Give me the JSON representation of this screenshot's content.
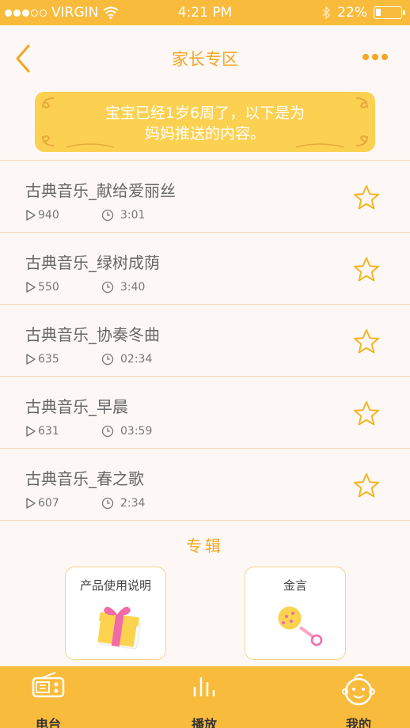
{
  "status_bar": {
    "carrier": "VIRGIN",
    "signal_filled": 3,
    "signal_total": 5,
    "time": "4:21 PM",
    "battery_percent": "22%",
    "battery_level": 0.22
  },
  "nav": {
    "title": "家长专区"
  },
  "banner": {
    "line1": "宝宝已经1岁6周了，以下是为",
    "line2": "妈妈推送的内容。"
  },
  "tracks": [
    {
      "title": "古典音乐_献给爱丽丝",
      "plays": "940",
      "duration": "3:01"
    },
    {
      "title": "古典音乐_绿树成荫",
      "plays": "550",
      "duration": "3:40"
    },
    {
      "title": "古典音乐_协奏冬曲",
      "plays": "635",
      "duration": "02:34"
    },
    {
      "title": "古典音乐_早晨",
      "plays": "631",
      "duration": "03:59"
    },
    {
      "title": "古典音乐_春之歌",
      "plays": "607",
      "duration": "2:34"
    }
  ],
  "albums": {
    "title": "专辑",
    "items": [
      {
        "label": "产品使用说明",
        "icon": "gift-icon"
      },
      {
        "label": "金言",
        "icon": "rattle-icon"
      }
    ]
  },
  "tabbar": {
    "items": [
      {
        "label": "电台",
        "icon": "radio-icon"
      },
      {
        "label": "播放",
        "icon": "equalizer-icon"
      },
      {
        "label": "我的",
        "icon": "baby-face-icon"
      }
    ]
  },
  "colors": {
    "accent": "#f9bb3c",
    "title": "#f5a623",
    "divider": "#f4d9b4"
  }
}
